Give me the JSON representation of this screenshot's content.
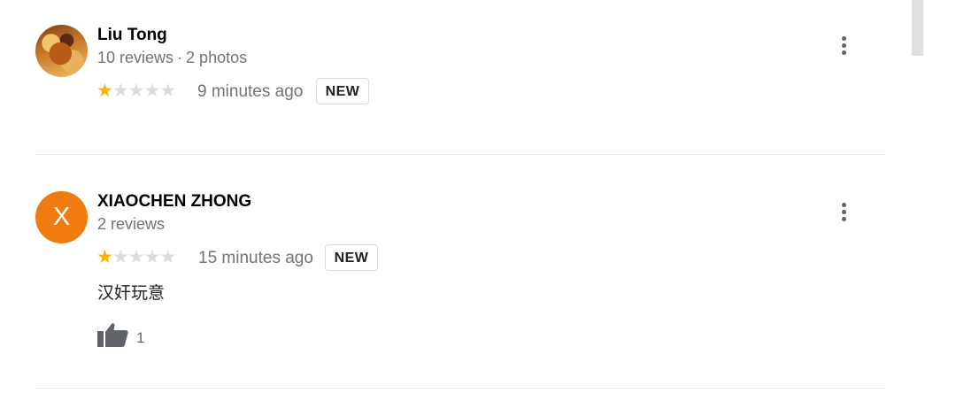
{
  "reviews": [
    {
      "name": "Liu Tong",
      "reviews_count": "10 reviews",
      "separator": "·",
      "photos_count": "2 photos",
      "rating": 1,
      "max_rating": 5,
      "time": "9 minutes ago",
      "badge": "NEW"
    },
    {
      "name": "XIAOCHEN ZHONG",
      "avatar_letter": "X",
      "reviews_count": "2 reviews",
      "rating": 1,
      "max_rating": 5,
      "time": "15 minutes ago",
      "badge": "NEW",
      "text": "汉奸玩意",
      "likes": "1"
    }
  ],
  "colors": {
    "star_filled": "#f9b400",
    "star_empty": "#dadce0",
    "avatar_orange": "#f07b10"
  },
  "icons": {
    "more": "more-vert-icon",
    "like": "thumb-up-icon",
    "star": "star-icon"
  }
}
